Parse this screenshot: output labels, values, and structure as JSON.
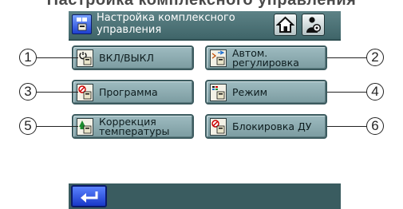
{
  "page_heading_cut": "Настройка комплексного управления",
  "header": {
    "title": "Настройка комплексного управления",
    "home_icon": "home-icon",
    "settings_icon": "user-settings-icon"
  },
  "menu": {
    "power": "ВКЛ/ВЫКЛ",
    "auto_regulation": "Автом. регулировка",
    "program": "Программа",
    "mode": "Режим",
    "temp_correction": "Коррекция температуры",
    "remote_lock": "Блокировка ДУ"
  },
  "callouts": [
    "1",
    "2",
    "3",
    "4",
    "5",
    "6"
  ],
  "footer": {
    "back_icon": "return-arrow-icon"
  },
  "colors": {
    "title_bar": "#4f7478",
    "button_face": "#8dabb0",
    "bottom_bar": "#3a5c60",
    "back_button": "#2a4fe0"
  }
}
